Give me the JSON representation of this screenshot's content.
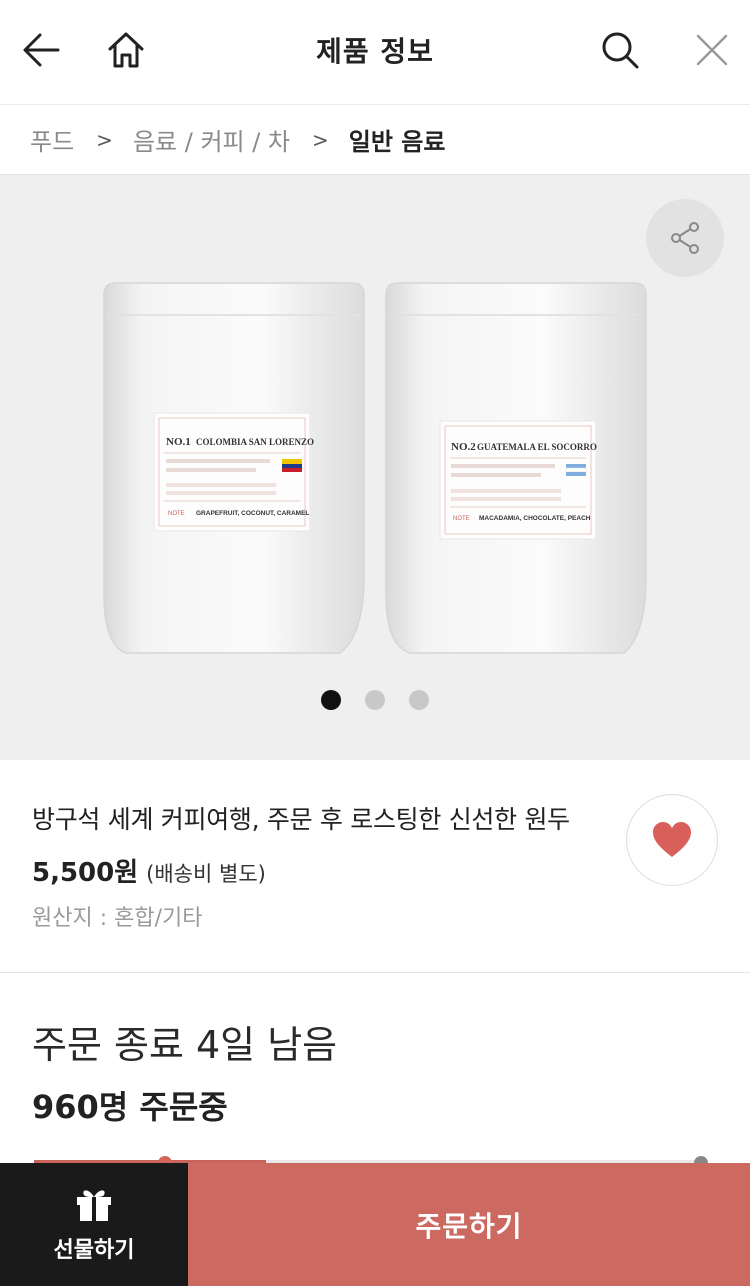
{
  "header": {
    "title": "제품 정보",
    "back_icon": "arrow-left-icon",
    "home_icon": "home-icon",
    "search_icon": "search-icon",
    "close_icon": "close-icon"
  },
  "breadcrumb": {
    "items": [
      "푸드",
      "음료 / 커피 / 차",
      "일반 음료"
    ],
    "separator": ">"
  },
  "gallery": {
    "bags": [
      {
        "number": "NO.1",
        "name": "COLOMBIA SAN LORENZO",
        "note_label": "NOTE",
        "note": "GRAPEFRUIT, COCONUT, CARAMEL"
      },
      {
        "number": "NO.2",
        "name": "GUATEMALA EL SOCORRO",
        "note_label": "NOTE",
        "note": "MACADAMIA, CHOCOLATE, PEACH"
      }
    ],
    "dots_total": 3,
    "active_dot": 1
  },
  "product": {
    "name": "방구석 세계 커피여행, 주문 후 로스팅한 신선한 원두",
    "price": "5,500원",
    "shipping": "(배송비 별도)",
    "origin": "원산지 : 혼합/기타",
    "wishlist_icon": "heart-icon"
  },
  "order_status": {
    "deadline": "주문 종료 4일 남음",
    "count": "960명 주문중"
  },
  "bottom_bar": {
    "gift_label": "선물하기",
    "gift_icon": "gift-icon",
    "order_label": "주문하기"
  },
  "colors": {
    "accent": "#cc6a62",
    "heart": "#d9605a",
    "dark": "#1a1a1a"
  }
}
